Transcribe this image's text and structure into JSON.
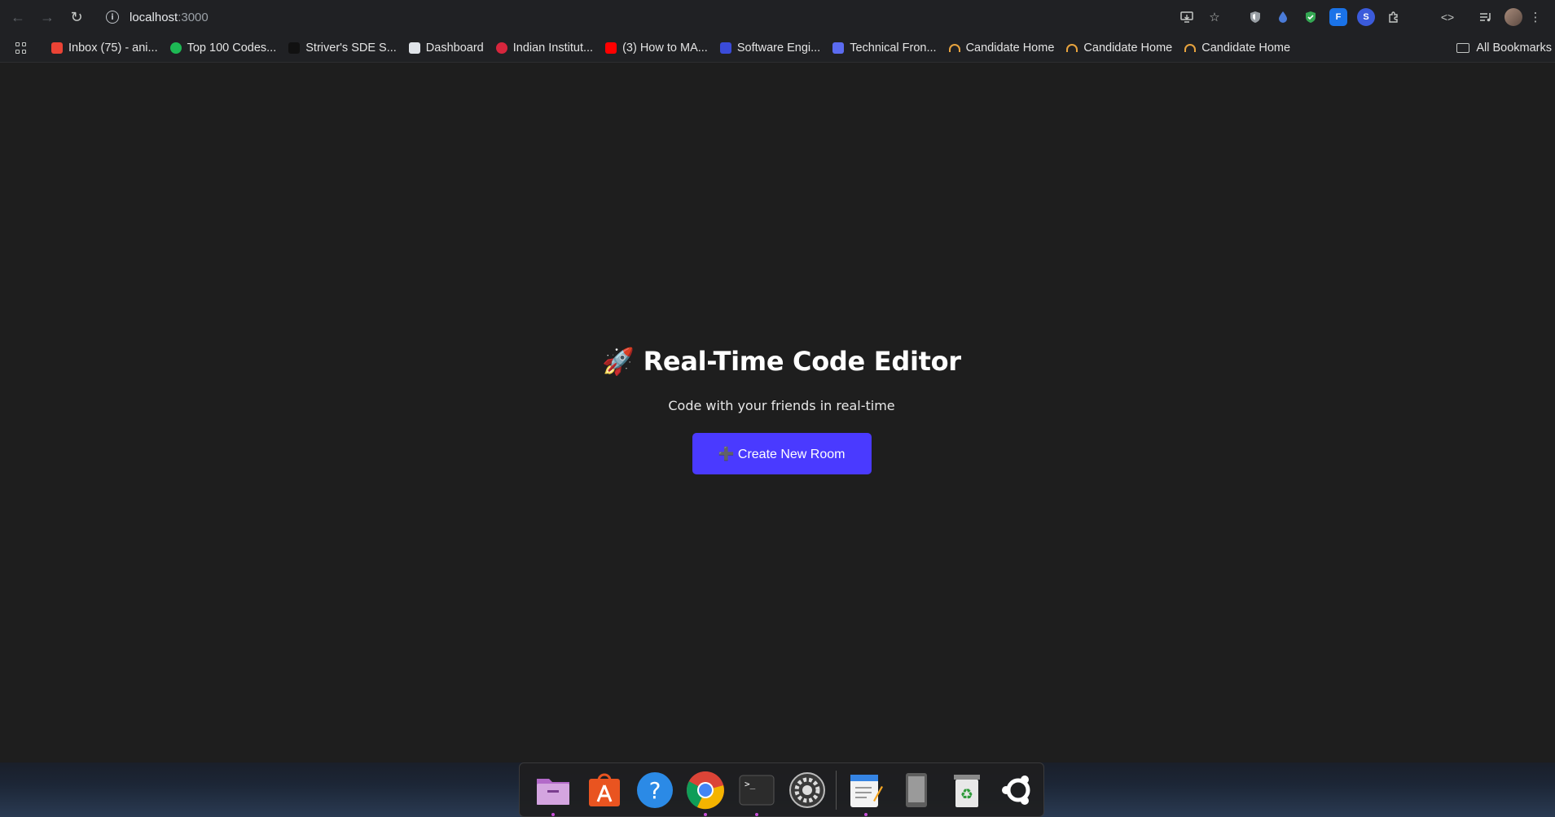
{
  "browser": {
    "url_host": "localhost",
    "url_port": ":3000"
  },
  "bookmarks": [
    {
      "label": "Inbox (75) - ani...",
      "icon": "gmail-icon",
      "color": "#ea4335"
    },
    {
      "label": "Top 100 Codes...",
      "icon": "codes-icon",
      "color": "#1db954"
    },
    {
      "label": "Striver's SDE S...",
      "icon": "tuf-icon",
      "color": "#111111"
    },
    {
      "label": "Dashboard",
      "icon": "dashboard-icon",
      "color": "#dfe3e8"
    },
    {
      "label": "Indian Institut...",
      "icon": "coursera-icon",
      "color": "#d7263d"
    },
    {
      "label": "(3) How to MA...",
      "icon": "youtube-icon",
      "color": "#ff0000"
    },
    {
      "label": "Software Engi...",
      "icon": "software-icon",
      "color": "#3a4bd8"
    },
    {
      "label": "Technical Fron...",
      "icon": "docs-icon",
      "color": "#5b6bf0"
    },
    {
      "label": "Candidate Home",
      "icon": "candidate-icon",
      "color": "#e7a33e"
    },
    {
      "label": "Candidate Home",
      "icon": "candidate-icon",
      "color": "#e7a33e"
    },
    {
      "label": "Candidate Home",
      "icon": "candidate-icon",
      "color": "#e7a33e"
    }
  ],
  "all_bookmarks_label": "All Bookmarks",
  "page": {
    "title": "🚀 Real-Time Code Editor",
    "subtitle": "Code with your friends in real-time",
    "create_button": "➕ Create New Room"
  },
  "dock": [
    {
      "name": "files-icon",
      "running": true
    },
    {
      "name": "app-center-icon",
      "running": false
    },
    {
      "name": "help-icon",
      "running": false
    },
    {
      "name": "chrome-icon",
      "running": true
    },
    {
      "name": "terminal-icon",
      "running": true
    },
    {
      "name": "settings-icon",
      "running": false
    },
    {
      "name": "text-editor-icon",
      "running": true
    },
    {
      "name": "tablet-icon",
      "running": false
    },
    {
      "name": "trash-icon",
      "running": false
    },
    {
      "name": "ubuntu-icon",
      "running": false
    }
  ],
  "colors": {
    "accent": "#4a3aff",
    "background": "#1e1e1e"
  }
}
